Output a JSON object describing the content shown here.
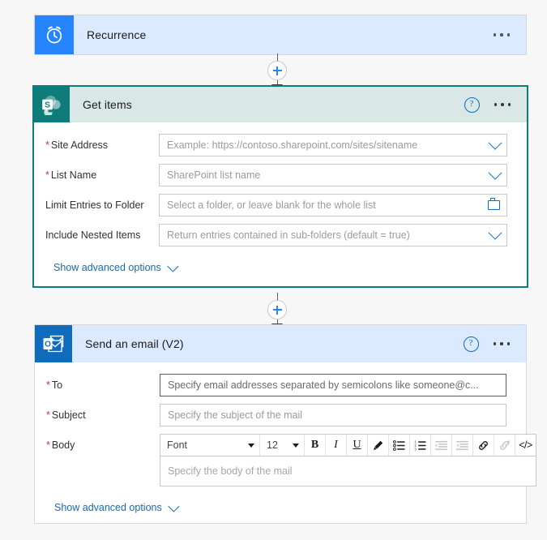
{
  "flow": {
    "steps": [
      {
        "id": "recurrence",
        "title": "Recurrence",
        "icon": "alarm-clock-icon",
        "icon_bg": "#2684ff",
        "header_bg": "#dbeafe"
      },
      {
        "id": "get-items",
        "title": "Get items",
        "icon": "sharepoint-icon",
        "icon_bg": "#0e7c7b",
        "header_bg": "#d9e8e7",
        "selected_border": "#0e7c7b",
        "help_label": "?",
        "advanced_link": "Show advanced options",
        "fields": [
          {
            "label": "Site Address",
            "required": true,
            "placeholder": "Example: https://contoso.sharepoint.com/sites/sitename",
            "control": "chevron-down-icon"
          },
          {
            "label": "List Name",
            "required": true,
            "placeholder": "SharePoint list name",
            "control": "chevron-down-icon"
          },
          {
            "label": "Limit Entries to Folder",
            "required": false,
            "placeholder": "Select a folder, or leave blank for the whole list",
            "control": "folder-icon"
          },
          {
            "label": "Include Nested Items",
            "required": false,
            "placeholder": "Return entries contained in sub-folders (default = true)",
            "control": "chevron-down-icon"
          }
        ]
      },
      {
        "id": "send-email",
        "title": "Send an email (V2)",
        "icon": "outlook-icon",
        "icon_bg": "#0f6cbd",
        "header_bg": "#dbeafe",
        "help_label": "?",
        "advanced_link": "Show advanced options",
        "fields": [
          {
            "label": "To",
            "required": true,
            "placeholder": "Specify email addresses separated by semicolons like someone@c...",
            "focused": true
          },
          {
            "label": "Subject",
            "required": true,
            "placeholder": "Specify the subject of the mail"
          },
          {
            "label": "Body",
            "required": true,
            "placeholder": "Specify the body of the mail"
          }
        ],
        "editor": {
          "font_value": "Font",
          "size_value": "12",
          "buttons": [
            {
              "name": "bold-icon",
              "label": "B",
              "enabled": true
            },
            {
              "name": "italic-icon",
              "label": "I",
              "enabled": true
            },
            {
              "name": "underline-icon",
              "label": "U",
              "enabled": true
            },
            {
              "name": "highlight-pen-icon",
              "label": "",
              "enabled": true
            },
            {
              "name": "bulleted-list-icon",
              "label": "",
              "enabled": true
            },
            {
              "name": "numbered-list-icon",
              "label": "",
              "enabled": true
            },
            {
              "name": "decrease-indent-icon",
              "label": "",
              "enabled": false
            },
            {
              "name": "increase-indent-icon",
              "label": "",
              "enabled": false
            },
            {
              "name": "insert-link-icon",
              "label": "",
              "enabled": true
            },
            {
              "name": "remove-link-icon",
              "label": "",
              "enabled": false
            },
            {
              "name": "code-view-icon",
              "label": "</>",
              "enabled": true
            }
          ]
        }
      }
    ],
    "connectors": [
      {
        "name": "add-step-between-recurrence-and-getitems"
      },
      {
        "name": "add-step-between-getitems-and-email"
      }
    ],
    "colors": {
      "accent_blue": "#0f6cbd",
      "plus_blue": "#2684ff",
      "required_red": "#d13438",
      "teal": "#0e7c7b"
    }
  }
}
